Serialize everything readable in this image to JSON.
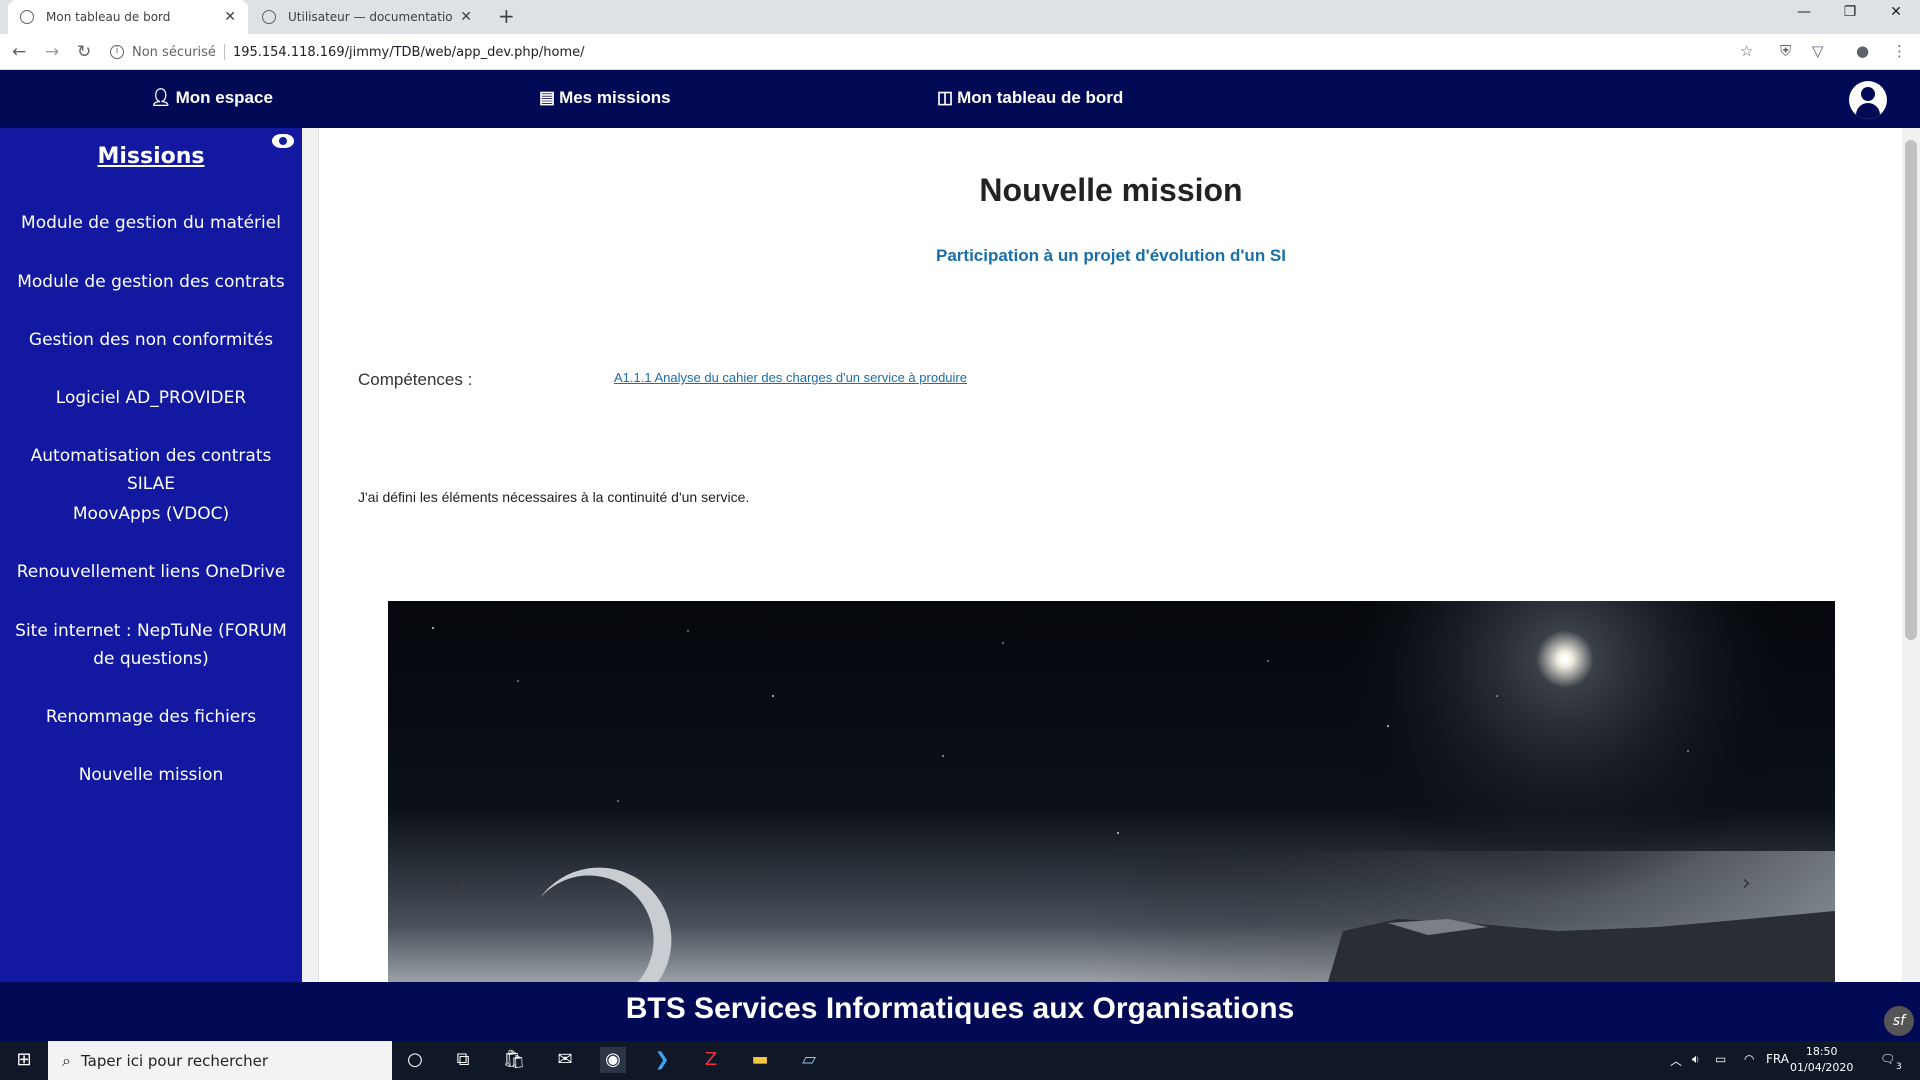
{
  "browser": {
    "tabs": [
      {
        "title": "Mon tableau de bord",
        "active": true
      },
      {
        "title": "Utilisateur — documentation Tab",
        "active": false
      }
    ],
    "security": "Non sécurisé",
    "url": "195.154.118.169/jimmy/TDB/web/app_dev.php/home/"
  },
  "nav": {
    "mon_espace": "Mon espace",
    "mes_missions": "Mes missions",
    "tableau_de_bord": "Mon tableau de bord"
  },
  "sidebar": {
    "title": "Missions",
    "items": [
      "Module de gestion du matériel",
      "Module de gestion des contrats",
      "Gestion des non conformités",
      "Logiciel AD_PROVIDER",
      "Automatisation des contrats SILAE",
      "MoovApps (VDOC)",
      "Renouvellement liens OneDrive",
      "Site internet : NepTuNe (FORUM de questions)",
      "Renommage des fichiers",
      "Nouvelle mission"
    ]
  },
  "main": {
    "title": "Nouvelle mission",
    "subtitle": "Participation à un projet d'évolution d'un SI",
    "competences_label": "Compétences :",
    "competence_link": "A1.1.1 Analyse du cahier des charges d'un service à produire",
    "description": "J'ai défini les éléments nécessaires à la continuité d'un service."
  },
  "footer": {
    "text": "BTS Services Informatiques aux Organisations"
  },
  "taskbar": {
    "search_placeholder": "Taper ici pour rechercher",
    "lang": "FRA",
    "time": "18:50",
    "date": "01/04/2020",
    "notification_count": "3"
  },
  "colors": {
    "nav_bg": "#030a55",
    "sidebar_bg": "#1219a0",
    "link": "#1a6fa8"
  }
}
